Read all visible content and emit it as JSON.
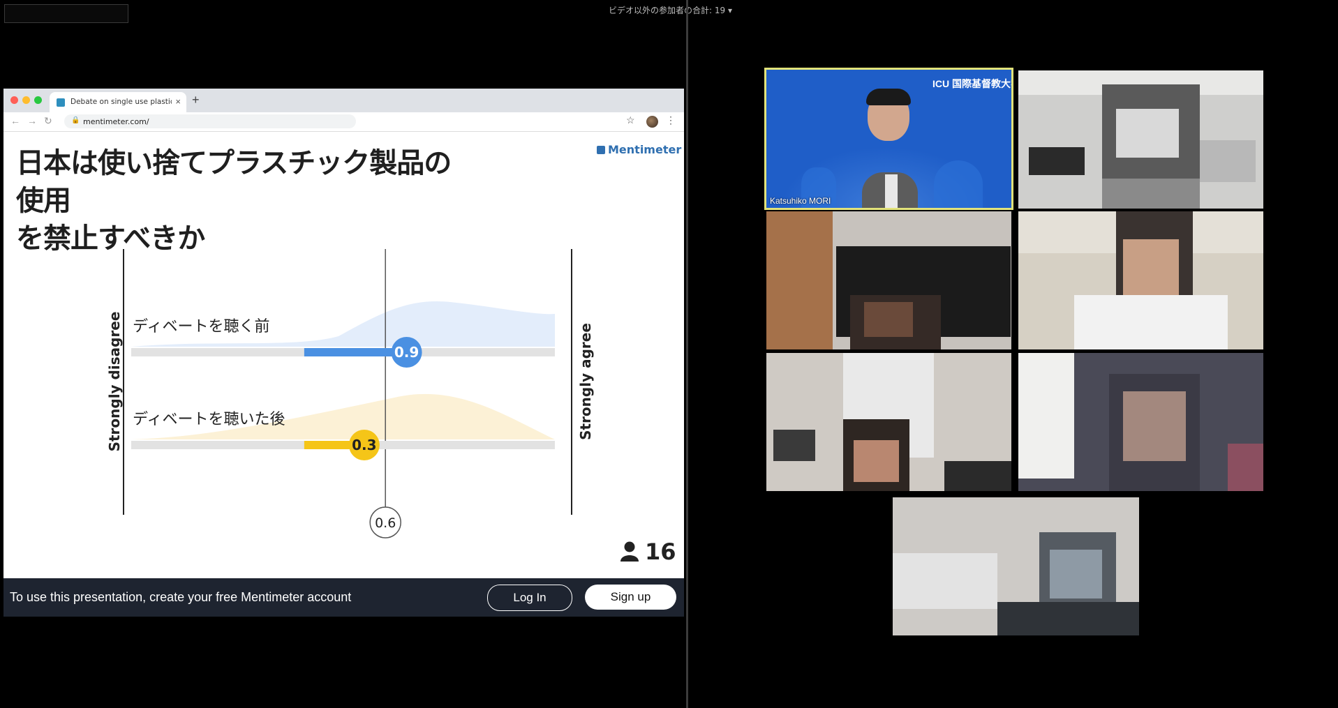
{
  "top_bar": {
    "participant_count": "ビデオ以外の参加者の合計: 19 ▾"
  },
  "browser": {
    "tab_title": "Debate on single use plastics |",
    "url": "mentimeter.com/"
  },
  "slide": {
    "title_line1": "日本は使い捨てプラスチック製品の使用",
    "title_line2": "を禁止すべきか",
    "brand": "Mentimeter",
    "participants_count": "16"
  },
  "chart_data": {
    "type": "scale",
    "left_label": "Strongly disagree",
    "right_label": "Strongly agree",
    "axis_min": -3,
    "axis_max": 3,
    "average_label": "0.6",
    "average_value": 0.6,
    "series": [
      {
        "name": "ディベートを聴く前",
        "value": 0.9,
        "label": "0.9",
        "color": "#4a90e2"
      },
      {
        "name": "ディベートを聴いた後",
        "value": 0.3,
        "label": "0.3",
        "color": "#f5c518"
      }
    ]
  },
  "footer": {
    "message": "To use this presentation, create your free Mentimeter account",
    "login_label": "Log In",
    "signup_label": "Sign up"
  },
  "participants": [
    {
      "name": "Katsuhiko MORI",
      "active": true,
      "logo": "ICU 国際基督教大学"
    }
  ]
}
